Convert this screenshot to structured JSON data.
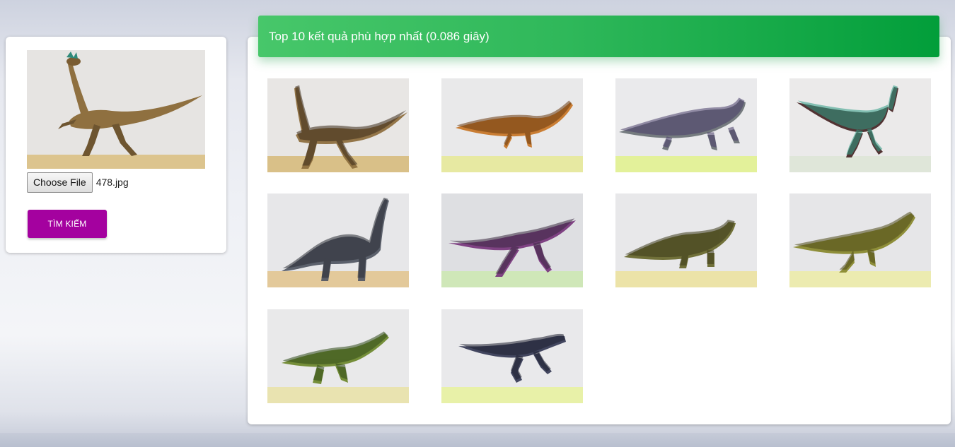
{
  "upload": {
    "choose_label": "Choose File",
    "file_name": "478.jpg",
    "search_label": "TÌM KIẾM"
  },
  "results": {
    "header_text": "Top 10 kết quả phù hợp nhất (0.086 giây)",
    "items": [
      {
        "body": "#8f7040",
        "accent": "#3a2a18",
        "ground": "#d9c088",
        "bg": "#e8e6e4",
        "pose": "runner"
      },
      {
        "body": "#c8782a",
        "accent": "#6a3a10",
        "ground": "#e7e9a2",
        "bg": "#e9e9ea",
        "pose": "ornithopod"
      },
      {
        "body": "#6f767a",
        "accent": "#4a3f6a",
        "ground": "#e3f19a",
        "bg": "#eaeaec",
        "pose": "hadrosaur"
      },
      {
        "body": "#4a2a2a",
        "accent": "#2f9d86",
        "ground": "#dfe6d9",
        "bg": "#ebeaea",
        "pose": "ostrich"
      },
      {
        "body": "#555a66",
        "accent": "#2a2c34",
        "ground": "#e3c99a",
        "bg": "#e7e7e9",
        "pose": "sauropod"
      },
      {
        "body": "#7a3a7e",
        "accent": "#3a2840",
        "ground": "#cfe7b8",
        "bg": "#dedfe2",
        "pose": "runner2"
      },
      {
        "body": "#6a6a30",
        "accent": "#3c3a1a",
        "ground": "#ece3a8",
        "bg": "#e8e8ea",
        "pose": "prosauropod"
      },
      {
        "body": "#8a8a30",
        "accent": "#4e4a18",
        "ground": "#ecebb0",
        "bg": "#e6e6e8",
        "pose": "ornithopod2"
      },
      {
        "body": "#6f8a30",
        "accent": "#2f4a18",
        "ground": "#e9e3b0",
        "bg": "#e9e9ea",
        "pose": "theropod"
      },
      {
        "body": "#3a3e58",
        "accent": "#1e2030",
        "ground": "#e8f1a8",
        "bg": "#e9e9eb",
        "pose": "theropod2"
      }
    ]
  }
}
